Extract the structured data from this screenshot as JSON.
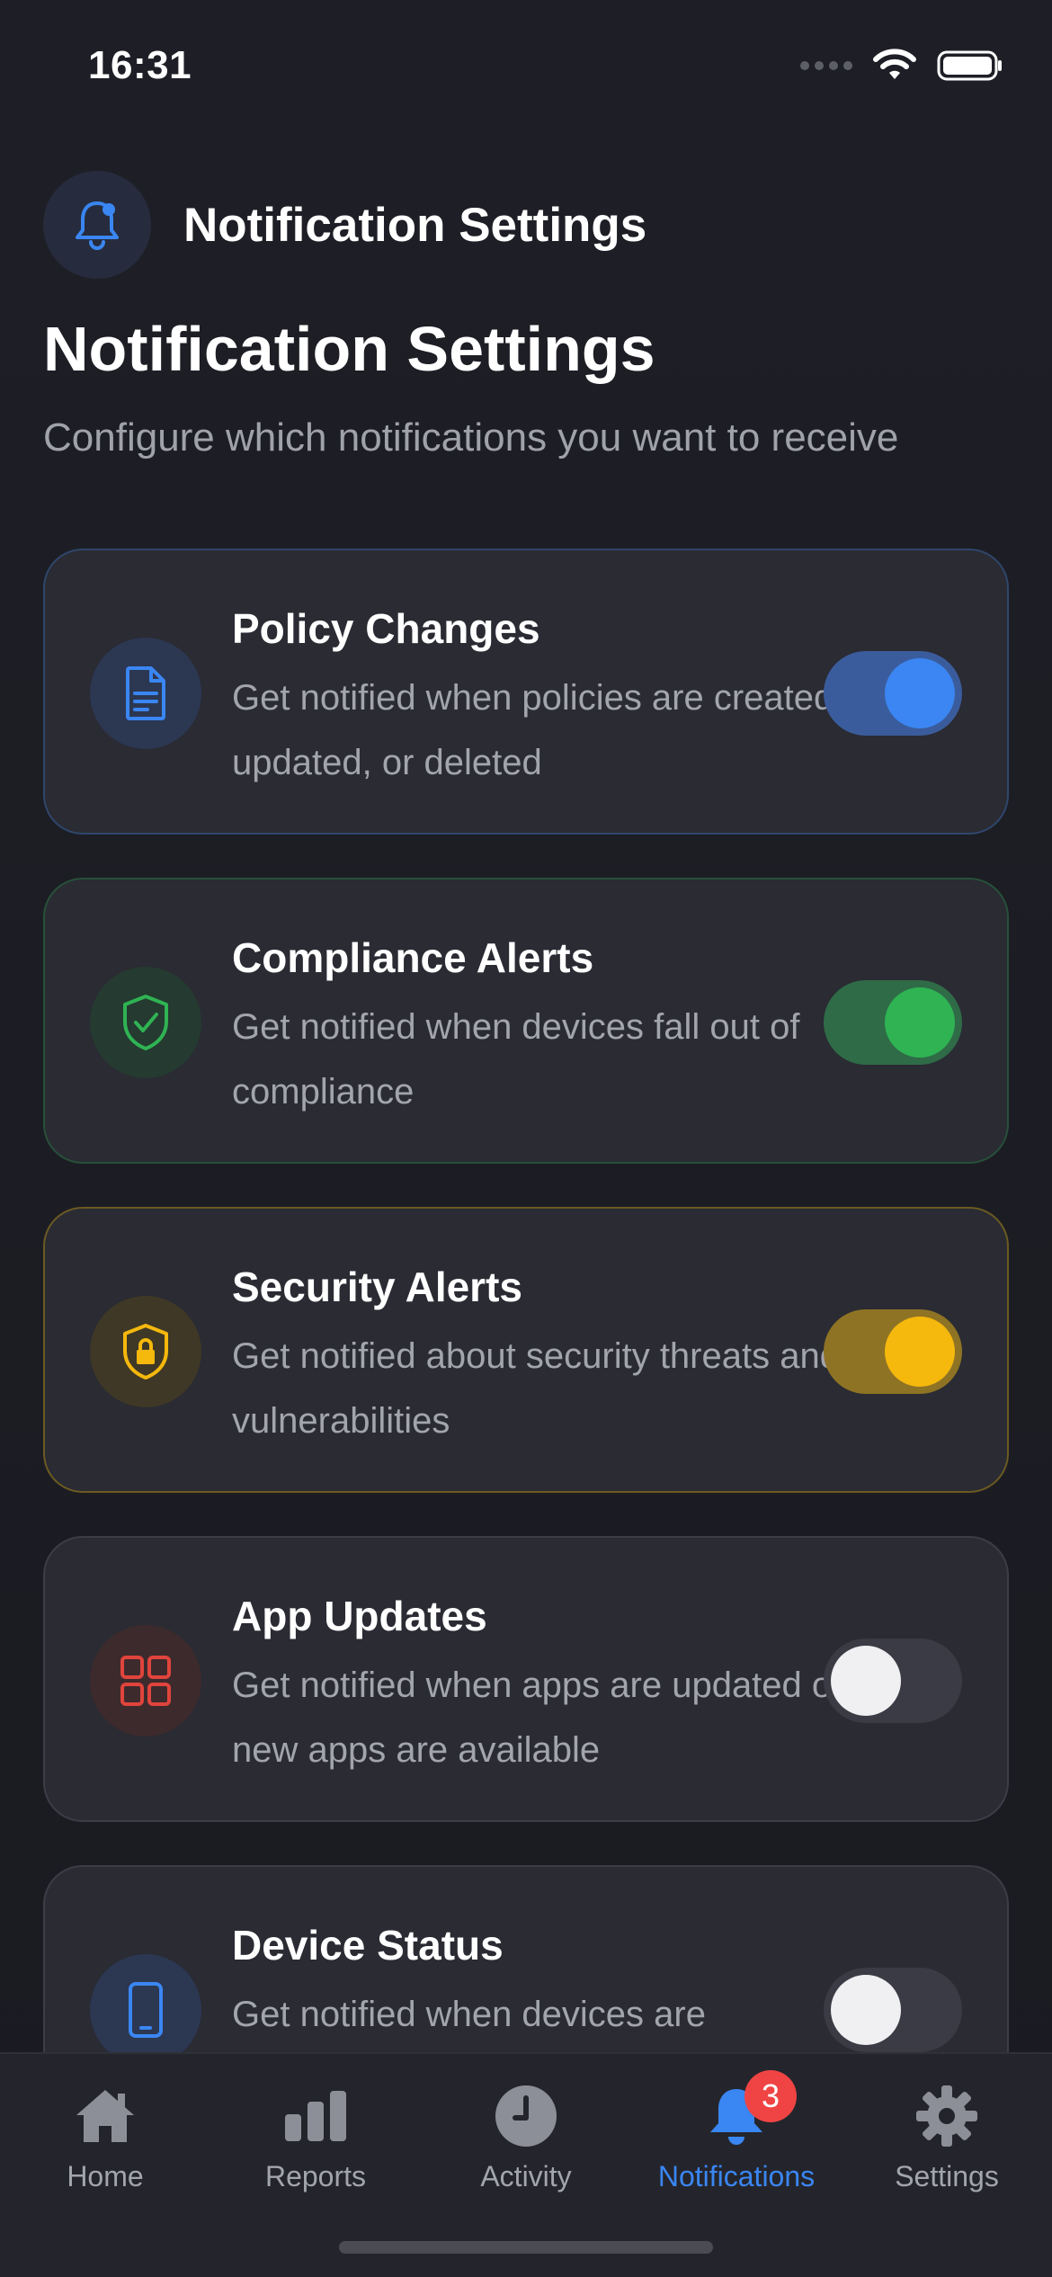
{
  "status_bar": {
    "time": "16:31"
  },
  "header": {
    "title": "Notification Settings",
    "icon": "bell-icon"
  },
  "page": {
    "title": "Notification Settings",
    "subtitle": "Configure which notifications you want to receive"
  },
  "settings": [
    {
      "title": "Policy Changes",
      "description": "Get notified when policies are created, updated, or deleted",
      "icon": "document-icon",
      "enabled": true,
      "accent": "#3b86f2"
    },
    {
      "title": "Compliance Alerts",
      "description": "Get notified when devices fall out of compliance",
      "icon": "shield-check-icon",
      "enabled": true,
      "accent": "#2fb353"
    },
    {
      "title": "Security Alerts",
      "description": "Get notified about security threats and vulnerabilities",
      "icon": "shield-lock-icon",
      "enabled": true,
      "accent": "#f5b80c"
    },
    {
      "title": "App Updates",
      "description": "Get notified when apps are updated or new apps are available",
      "icon": "apps-grid-icon",
      "enabled": false,
      "accent": "#e0443c"
    },
    {
      "title": "Device Status",
      "description": "Get notified when devices are",
      "icon": "phone-icon",
      "enabled": false,
      "accent": "#3b86f2"
    }
  ],
  "tab_bar": {
    "tabs": [
      {
        "label": "Home",
        "icon": "home-icon",
        "active": false
      },
      {
        "label": "Reports",
        "icon": "bar-chart-icon",
        "active": false
      },
      {
        "label": "Activity",
        "icon": "clock-icon",
        "active": false
      },
      {
        "label": "Notifications",
        "icon": "bell-icon",
        "active": true,
        "badge": "3"
      },
      {
        "label": "Settings",
        "icon": "gear-icon",
        "active": false
      }
    ]
  },
  "colors": {
    "background": "#1c1c22",
    "card": "#2a2b33",
    "accent_blue": "#3a86f2",
    "badge_red": "#f04444"
  }
}
